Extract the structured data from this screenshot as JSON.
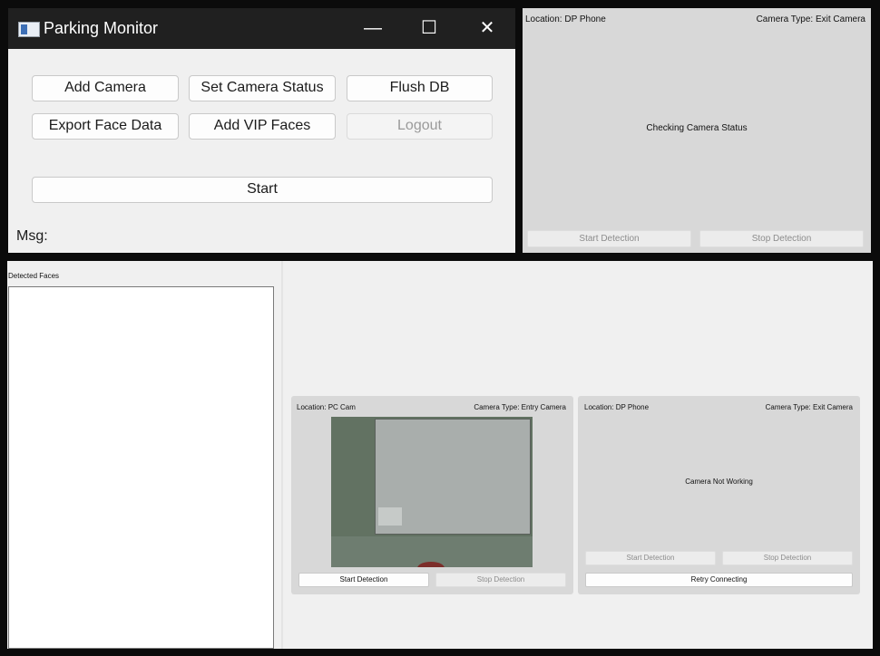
{
  "main_window": {
    "title": "Parking Monitor",
    "controls": {
      "minimize": "—",
      "maximize": "☐",
      "close": "✕"
    },
    "buttons": {
      "add_camera": "Add Camera",
      "set_camera_status": "Set Camera Status",
      "flush_db": "Flush DB",
      "export_face_data": "Export Face Data",
      "add_vip_faces": "Add VIP Faces",
      "logout": "Logout",
      "start": "Start"
    },
    "msg_label": "Msg:"
  },
  "camera_panel_top": {
    "location": "Location: DP Phone",
    "camera_type": "Camera Type: Exit Camera",
    "status": "Checking Camera Status",
    "start_detection": "Start Detection",
    "stop_detection": "Stop Detection"
  },
  "detected_faces": {
    "label": "Detected Faces"
  },
  "camera_panels": [
    {
      "location": "Location: PC Cam",
      "camera_type": "Camera Type: Entry Camera",
      "start_detection": "Start Detection",
      "stop_detection": "Stop Detection"
    },
    {
      "location": "Location: DP Phone",
      "camera_type": "Camera Type: Exit Camera",
      "status": "Camera Not Working",
      "start_detection": "Start Detection",
      "stop_detection": "Stop Detection",
      "retry": "Retry Connecting"
    }
  ]
}
